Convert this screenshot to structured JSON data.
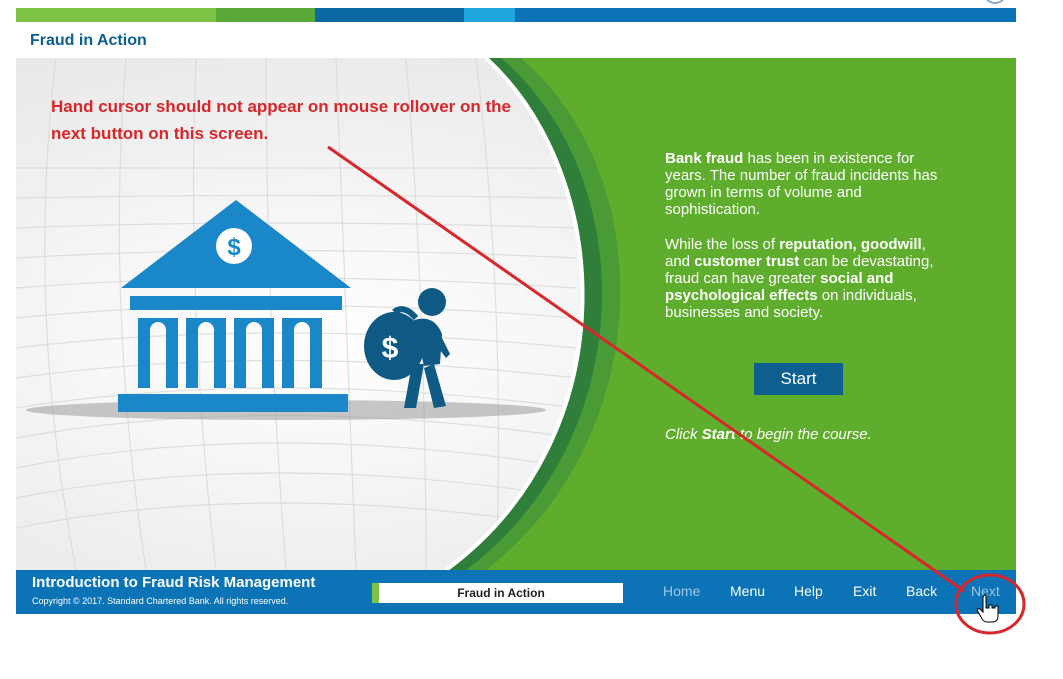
{
  "header": {
    "page_title": "Fraud in Action"
  },
  "annotation": {
    "text": "Hand cursor should not appear on mouse rollover on the next button on this screen."
  },
  "panel": {
    "p1_bold": "Bank fraud",
    "p1_rest": " has been in existence for years. The number of fraud incidents has grown in terms of volume and sophistication.",
    "p2_a": "While the loss of ",
    "p2_b": "reputation, goodwill",
    "p2_c": ", and ",
    "p2_d": "customer trust",
    "p2_e": " can be devastating, fraud can have greater ",
    "p2_f": "social and psychological effects",
    "p2_g": " on individuals, businesses and society.",
    "start_label": "Start",
    "instr_a": "Click ",
    "instr_b": "Start",
    "instr_c": " to begin the course."
  },
  "illustration": {
    "bank_symbol": "$",
    "bag_symbol": "$"
  },
  "footer": {
    "course_title": "Introduction to Fraud Risk Management",
    "copyright": "Copyright © 2017. Standard Chartered Bank. All rights reserved.",
    "progress_label": "Fraud in Action",
    "nav": {
      "home": "Home",
      "menu": "Menu",
      "help": "Help",
      "exit": "Exit",
      "back": "Back",
      "next": "Next"
    }
  },
  "colors": {
    "green": "#5fad2c",
    "blue": "#0b73b6",
    "annotation_red": "#d8262a",
    "bank_blue": "#1a87c9"
  },
  "icons": {
    "bank": "bank-building-icon",
    "thief": "thief-with-moneybag-icon",
    "cursor": "hand-cursor-icon"
  }
}
